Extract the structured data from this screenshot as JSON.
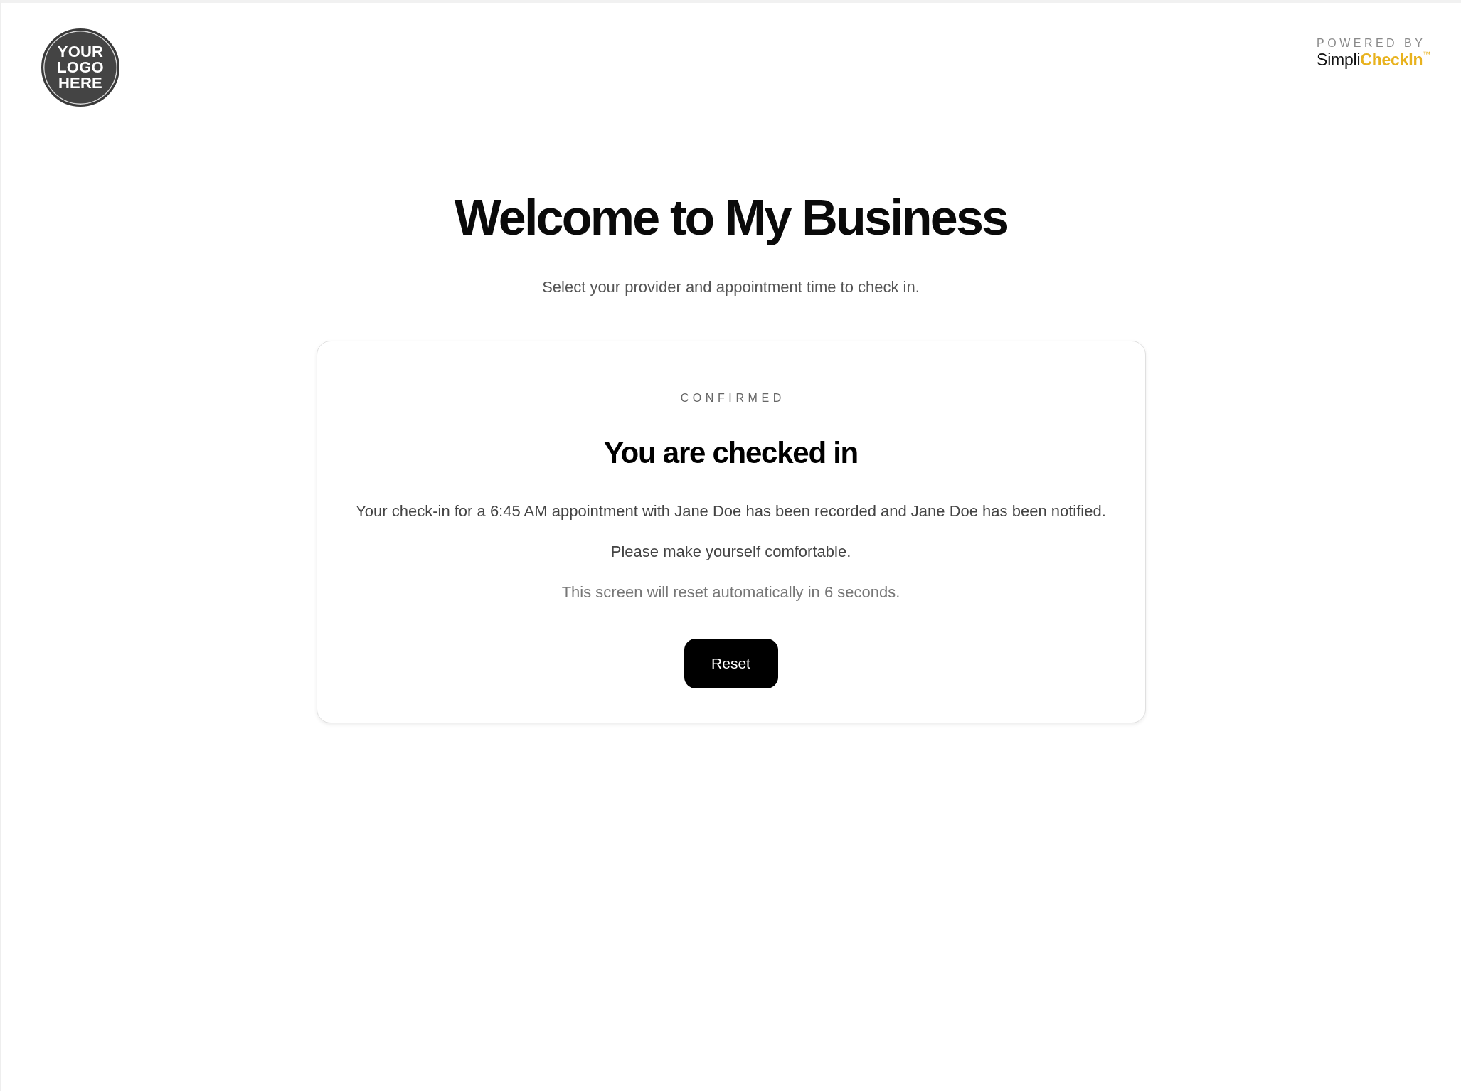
{
  "logo": {
    "lines": [
      "YOUR",
      "LOGO",
      "HERE"
    ]
  },
  "powered_by": {
    "label": "POWERED BY",
    "brand": "Simpli**CheckIn**$^{™}$"
  },
  "header": {
    "title": "Welcome to My Business",
    "subtitle": "Select your provider and appointment time to check in."
  },
  "confirmation": {
    "eyebrow": "CONFIRMED",
    "heading": "You are checked in",
    "message": "Your check-in for a 6:45 AM appointment with Jane Doe has been recorded and Jane Doe has been notified.",
    "comfort": "Please make yourself comfortable.",
    "countdown": "This screen will reset automatically in 6 seconds.",
    "button": "Reset"
  }
}
